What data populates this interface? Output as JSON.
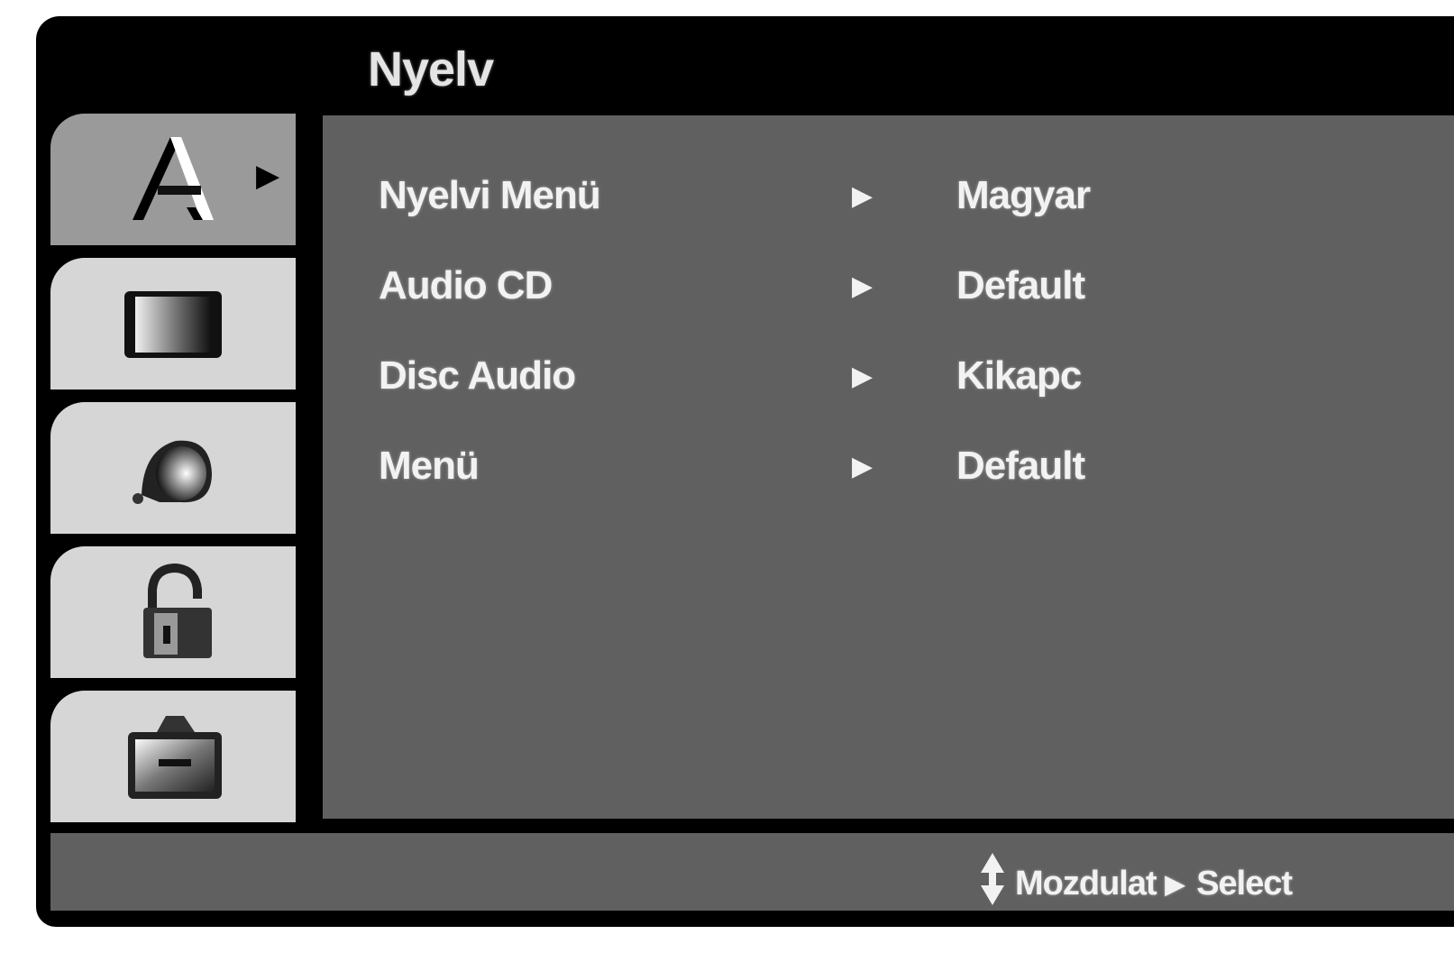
{
  "menu": {
    "title": "Nyelv"
  },
  "tabs": [
    {
      "icon": "language-icon",
      "active": true,
      "arrow": "▶"
    },
    {
      "icon": "display-icon",
      "active": false
    },
    {
      "icon": "audio-icon",
      "active": false
    },
    {
      "icon": "lock-icon",
      "active": false
    },
    {
      "icon": "others-icon",
      "active": false
    }
  ],
  "settings": [
    {
      "label": "Nyelvi Menü",
      "arrow": "▶",
      "value": "Magyar"
    },
    {
      "label": "Audio CD",
      "arrow": "▶",
      "value": "Default"
    },
    {
      "label": "Disc Audio",
      "arrow": "▶",
      "value": "Kikapc"
    },
    {
      "label": "Menü",
      "arrow": "▶",
      "value": "Default"
    }
  ],
  "footer": {
    "move_label": "Mozdulat",
    "select_arrow": "▶",
    "select_label": "Select"
  },
  "colors": {
    "frame": "#000000",
    "panel": "#606060",
    "tab": "#d6d6d6",
    "tab_active": "#9a9a9a",
    "text": "#f2f2f2"
  }
}
